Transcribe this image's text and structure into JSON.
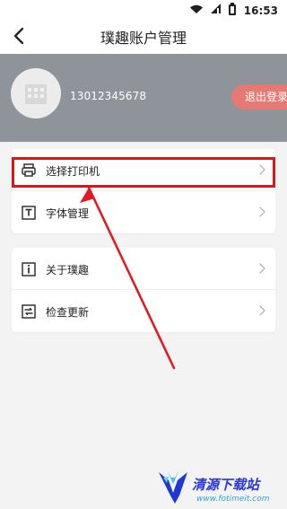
{
  "status_bar": {
    "time": "16:53",
    "icons": [
      "wifi-icon",
      "signal-icon",
      "battery-icon"
    ]
  },
  "header": {
    "title": "璞趣账户管理",
    "back_icon": "chevron-left-icon"
  },
  "profile": {
    "phone": "13012345678",
    "logout_label": "退出登录",
    "avatar_icon": "building-icon"
  },
  "sections": [
    {
      "items": [
        {
          "label": "选择打印机",
          "icon": "printer-icon"
        },
        {
          "label": "字体管理",
          "icon": "text-icon"
        }
      ]
    },
    {
      "items": [
        {
          "label": "关于璞趣",
          "icon": "info-icon"
        },
        {
          "label": "检查更新",
          "icon": "update-icon"
        }
      ]
    }
  ],
  "watermark": {
    "title": "清源下载站",
    "url": "www.fotimeit.com"
  },
  "colors": {
    "banner": "#8e949a",
    "logout": "#e57a74",
    "highlight": "#d9161c",
    "watermark_primary": "#2a36d6",
    "watermark_secondary": "#27a7cf"
  }
}
